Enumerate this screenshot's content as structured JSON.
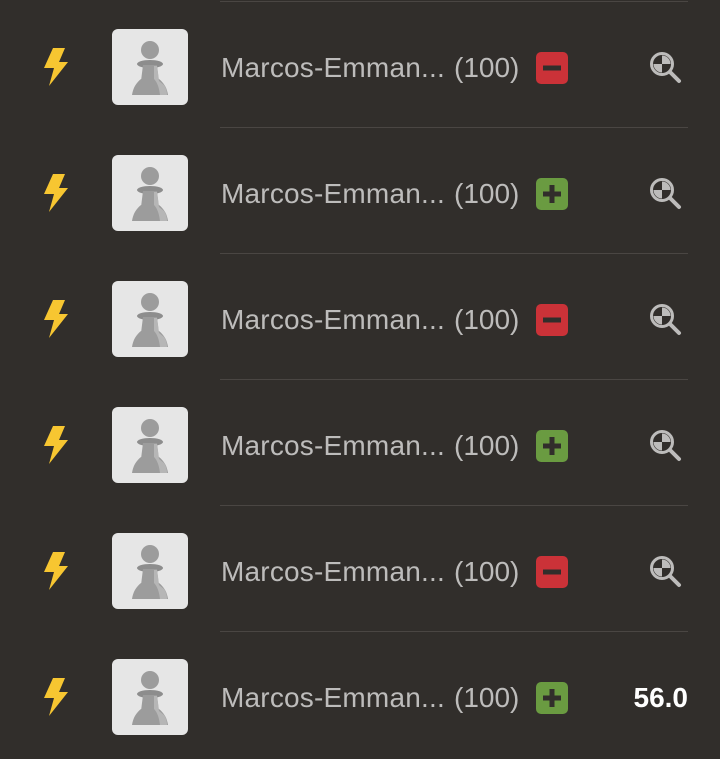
{
  "colors": {
    "background": "#312e2b",
    "divider": "#4a4643",
    "bolt": "#f7c631",
    "loss": "#cb3238",
    "win": "#6a9b41",
    "avatar_bg": "#e6e6e6",
    "text": "#bdbcbb",
    "score": "#ffffff"
  },
  "rows": [
    {
      "time_class_icon": "bolt-icon",
      "avatar_icon": "pawn-icon",
      "username": "Marcos-Emman...",
      "rating": "(100)",
      "result": "loss",
      "result_icon": "minus-icon",
      "trailing_icon": "magnifier-icon"
    },
    {
      "time_class_icon": "bolt-icon",
      "avatar_icon": "pawn-icon",
      "username": "Marcos-Emman...",
      "rating": "(100)",
      "result": "win",
      "result_icon": "plus-icon",
      "trailing_icon": "magnifier-icon"
    },
    {
      "time_class_icon": "bolt-icon",
      "avatar_icon": "pawn-icon",
      "username": "Marcos-Emman...",
      "rating": "(100)",
      "result": "loss",
      "result_icon": "minus-icon",
      "trailing_icon": "magnifier-icon"
    },
    {
      "time_class_icon": "bolt-icon",
      "avatar_icon": "pawn-icon",
      "username": "Marcos-Emman...",
      "rating": "(100)",
      "result": "win",
      "result_icon": "plus-icon",
      "trailing_icon": "magnifier-icon"
    },
    {
      "time_class_icon": "bolt-icon",
      "avatar_icon": "pawn-icon",
      "username": "Marcos-Emman...",
      "rating": "(100)",
      "result": "loss",
      "result_icon": "minus-icon",
      "trailing_icon": "magnifier-icon"
    },
    {
      "time_class_icon": "bolt-icon",
      "avatar_icon": "pawn-icon",
      "username": "Marcos-Emman...",
      "rating": "(100)",
      "result": "win",
      "result_icon": "plus-icon",
      "score": "56.0"
    }
  ]
}
